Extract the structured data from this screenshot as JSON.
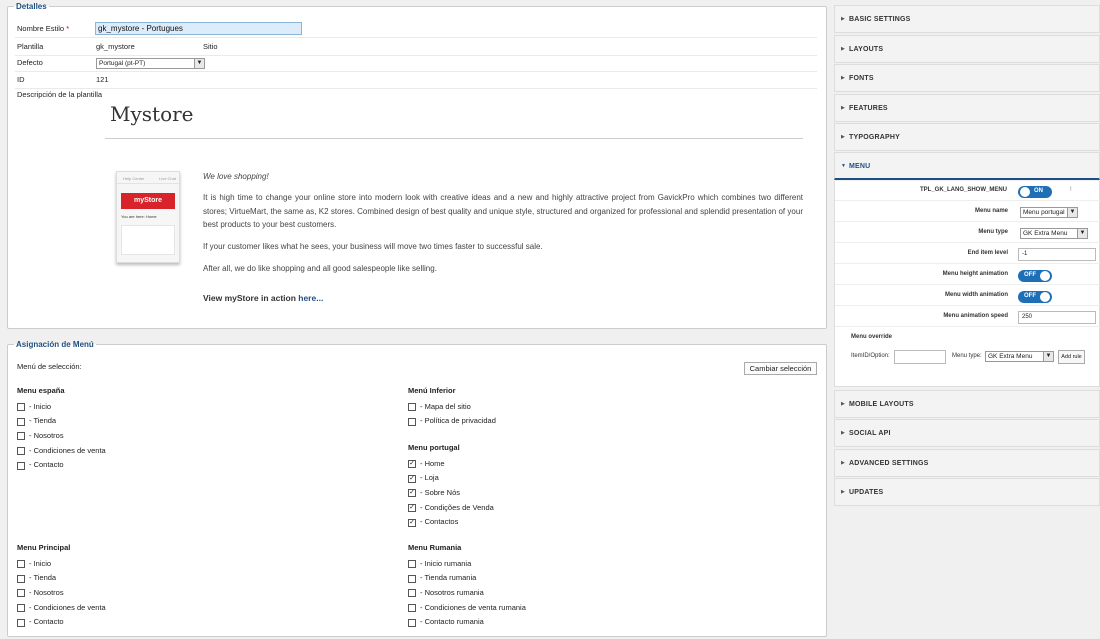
{
  "detalles": {
    "legend": "Detalles",
    "nombre_label": "Nombre Estilo",
    "required_mark": "*",
    "nombre_value": "gk_mystore - Portugues",
    "plantilla_label": "Plantilla",
    "plantilla_value": "gk_mystore",
    "plantilla_scope": "Sitio",
    "defecto_label": "Defecto",
    "defecto_value": "Portugal (pt-PT)",
    "id_label": "ID",
    "id_value": "121",
    "descripcion_label": "Descripción de la plantilla",
    "template": {
      "title": "Mystore",
      "thumb_nav_left": "Help Center",
      "thumb_nav_right": "Live Chat",
      "thumb_logo": "myStore",
      "thumb_crumb": "You are here:  Home",
      "love": "We love shopping!",
      "main": "It is high time to change your online store into modern look with creative ideas and a new and highly attractive project from GavickPro which combines two different stores; VirtueMart, the same as, K2 stores. Combined design of best quality and unique style, structured and organized for professional and splendid presentation of your best products to your best customers.",
      "customer": "If your customer likes what he sees, your business will move two times faster to successful sale.",
      "after": "After all, we do like shopping and all good salespeople like selling.",
      "view_prefix": "View myStore in action ",
      "view_link": "here..."
    }
  },
  "asignacion": {
    "legend": "Asignación de Menú",
    "menu_sel_label": "Menú de selección:",
    "cambiar_button": "Cambiar selección",
    "groups": [
      {
        "title": "Menu españa",
        "items": [
          {
            "label": "- Inicio",
            "checked": false
          },
          {
            "label": "- Tienda",
            "checked": false
          },
          {
            "label": "- Nosotros",
            "checked": false
          },
          {
            "label": "- Condiciones de venta",
            "checked": false
          },
          {
            "label": "- Contacto",
            "checked": false
          }
        ]
      },
      {
        "title": "Menú Inferior",
        "items": [
          {
            "label": "- Mapa del sitio",
            "checked": false
          },
          {
            "label": "- Política de privacidad",
            "checked": false
          }
        ]
      },
      {
        "title": "Menu portugal",
        "items": [
          {
            "label": "- Home",
            "checked": true
          },
          {
            "label": "- Loja",
            "checked": true
          },
          {
            "label": "- Sobre Nós",
            "checked": true
          },
          {
            "label": "- Condições de Venda",
            "checked": true
          },
          {
            "label": "- Contactos",
            "checked": true
          }
        ]
      },
      {
        "title": "Menu Principal",
        "items": [
          {
            "label": "- Inicio",
            "checked": false
          },
          {
            "label": "- Tienda",
            "checked": false
          },
          {
            "label": "- Nosotros",
            "checked": false
          },
          {
            "label": "- Condiciones de venta",
            "checked": false
          },
          {
            "label": "- Contacto",
            "checked": false
          }
        ]
      },
      {
        "title": "Menu Rumania",
        "items": [
          {
            "label": "- Inicio rumania",
            "checked": false
          },
          {
            "label": "- Tienda rumania",
            "checked": false
          },
          {
            "label": "- Nosotros rumania",
            "checked": false
          },
          {
            "label": "- Condiciones de venta rumania",
            "checked": false
          },
          {
            "label": "- Contacto rumania",
            "checked": false
          }
        ]
      }
    ]
  },
  "sidebar": {
    "sections": [
      "BASIC SETTINGS",
      "LAYOUTS",
      "FONTS",
      "FEATURES",
      "TYPOGRAPHY",
      "MENU",
      "MOBILE LAYOUTS",
      "SOCIAL API",
      "ADVANCED SETTINGS",
      "UPDATES"
    ],
    "menu": {
      "lang_label": "TPL_GK_LANG_SHOW_MENU",
      "lang_toggle": "ON",
      "lang_mark": "!",
      "name_label": "Menu name",
      "name_value": "Menu portugal",
      "type_label": "Menu type",
      "type_value": "GK Extra Menu",
      "end_label": "End item level",
      "end_value": "-1",
      "height_label": "Menu height animation",
      "height_toggle": "OFF",
      "width_label": "Menu width animation",
      "width_toggle": "OFF",
      "speed_label": "Menu animation speed",
      "speed_value": "250",
      "override_title": "Menu override",
      "override_item_label": "ItemID/Option:",
      "override_type_label": "Menu type:",
      "override_type_value": "GK Extra Menu",
      "add_rule": "Add rule"
    }
  },
  "colors": {
    "accent": "#1f4f82",
    "toggle": "#1f6fb6",
    "logo_red": "#d8232a"
  }
}
